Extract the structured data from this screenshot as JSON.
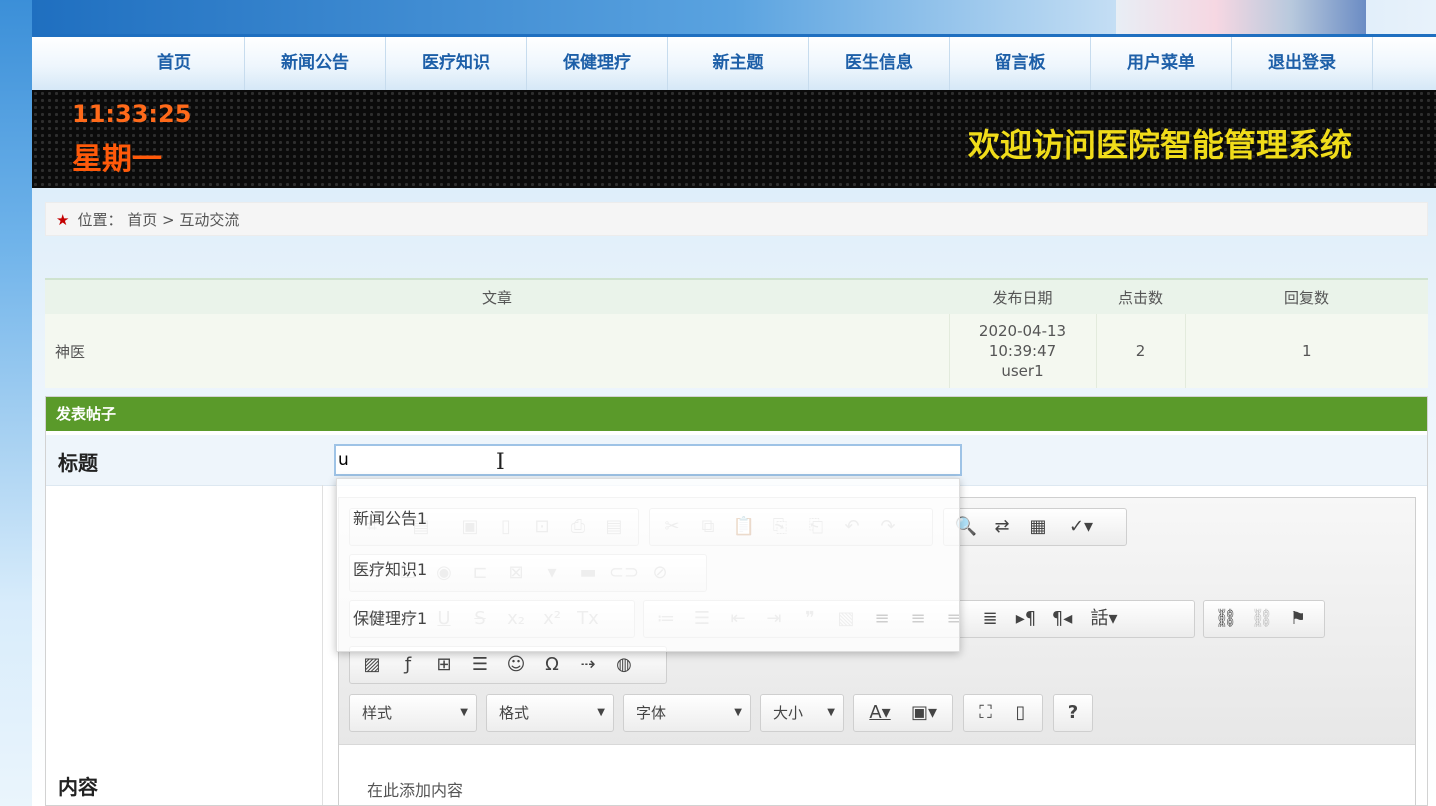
{
  "nav": {
    "items": [
      "首页",
      "新闻公告",
      "医疗知识",
      "保健理疗",
      "新主题",
      "医生信息",
      "留言板",
      "用户菜单",
      "退出登录"
    ]
  },
  "banner": {
    "time": "11:33:25",
    "weekday": "星期一",
    "welcome": "欢迎访问医院智能管理系统"
  },
  "breadcrumb": {
    "prefix": "位置：",
    "home": "首页",
    "sep": ">",
    "current": "互动交流"
  },
  "article_table": {
    "headers": [
      "文章",
      "发布日期",
      "点击数",
      "回复数"
    ],
    "rows": [
      {
        "title": "神医",
        "date": "2020-04-13 10:39:47",
        "author": "user1",
        "clicks": "2",
        "replies": "1"
      }
    ]
  },
  "post_form": {
    "header": "发表帖子",
    "title_label": "标题",
    "title_value": "u",
    "content_label": "内容",
    "content_placeholder": "在此添加内容",
    "combos": [
      "样式",
      "格式",
      "字体",
      "大小"
    ]
  },
  "autocomplete": {
    "items": [
      "新闻公告1",
      "医疗知识1",
      "保健理疗1"
    ]
  },
  "colors": {
    "nav_text": "#1d5fa8",
    "post_header": "#5a9a2a",
    "clock": "#ff6a1a",
    "welcome": "#f0dc1a",
    "breadcrumb_star": "#c40000"
  }
}
